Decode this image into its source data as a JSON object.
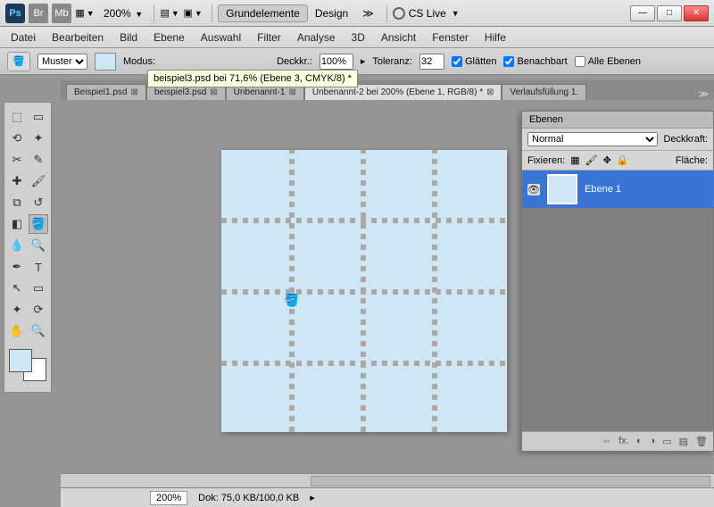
{
  "titlebar": {
    "zoom": "200%",
    "workspace_active": "Grundelemente",
    "workspace_other": "Design",
    "more": "≫",
    "cslive": "CS Live",
    "min": "—",
    "max": "□",
    "close": "✕"
  },
  "menu": [
    "Datei",
    "Bearbeiten",
    "Bild",
    "Ebene",
    "Auswahl",
    "Filter",
    "Analyse",
    "3D",
    "Ansicht",
    "Fenster",
    "Hilfe"
  ],
  "options": {
    "fill_label": "Muster",
    "mode_label": "Modus:",
    "opacity_label": "Deckkr.:",
    "opacity_value": "100%",
    "tolerance_label": "Toleranz:",
    "tolerance_value": "32",
    "antialias": "Glätten",
    "contiguous": "Benachbart",
    "all_layers": "Alle Ebenen"
  },
  "tooltip": "beispiel3.psd bei 71,6% (Ebene 3, CMYK/8) *",
  "tabs": [
    {
      "label": "Beispiel1.psd",
      "dirty": false,
      "active": false
    },
    {
      "label": "beispiel3.psd",
      "dirty": false,
      "active": false
    },
    {
      "label": "Unbenannt-1",
      "dirty": false,
      "active": false
    },
    {
      "label": "Unbenannt-2 bei 200% (Ebene 1, RGB/8) *",
      "dirty": true,
      "active": true
    },
    {
      "label": "Verlaufsfüllung 1.",
      "dirty": false,
      "active": false
    }
  ],
  "status": {
    "zoom": "200%",
    "doc": "Dok: 75,0 KB/100,0 KB"
  },
  "layers": {
    "title": "Ebenen",
    "blend": "Normal",
    "opacity_label": "Deckkraft:",
    "lock_label": "Fixieren:",
    "fill_label": "Fläche:",
    "items": [
      {
        "name": "Ebene 1"
      }
    ],
    "footer": [
      "⇔",
      "fx.",
      "◐",
      "◑",
      "▭",
      "�動",
      "🗑"
    ]
  }
}
